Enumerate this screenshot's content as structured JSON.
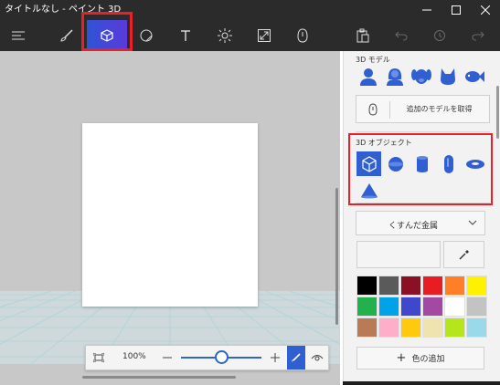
{
  "window": {
    "title": "タイトルなし - ペイント 3D",
    "controls": [
      "minimize-icon",
      "maximize-icon",
      "close-icon"
    ]
  },
  "toolbar": {
    "tools": [
      {
        "name": "menu",
        "icon": "hamburger-menu-icon"
      },
      {
        "name": "brushes",
        "icon": "brush-icon"
      },
      {
        "name": "3d-shapes",
        "icon": "3d-cube-icon",
        "active": true
      },
      {
        "name": "2d-shapes",
        "icon": "sticker-icon"
      },
      {
        "name": "text",
        "icon": "text-icon"
      },
      {
        "name": "effects",
        "icon": "sun-icon"
      },
      {
        "name": "canvas",
        "icon": "canvas-resize-icon"
      },
      {
        "name": "3d-library",
        "icon": "library-icon"
      },
      {
        "name": "paste",
        "icon": "paste-icon"
      },
      {
        "name": "undo",
        "icon": "undo-icon"
      },
      {
        "name": "history",
        "icon": "history-icon"
      },
      {
        "name": "redo",
        "icon": "redo-icon"
      }
    ],
    "accent": "#3b4fd8"
  },
  "zoom": {
    "percent": "100%",
    "level": 0.5,
    "icons": [
      "fit-screen-icon",
      "zoom-out-icon",
      "zoom-in-icon",
      "pen-icon",
      "view-icon"
    ]
  },
  "panel": {
    "models_title": "3D モデル",
    "models": [
      "man-icon",
      "woman-icon",
      "dog-icon",
      "cat-icon",
      "fish-icon"
    ],
    "get_more_label": "追加のモデルを取得",
    "objects_title": "3D オブジェクト",
    "objects": [
      "cube-icon",
      "sphere-icon",
      "cylinder-icon",
      "capsule-icon",
      "torus-icon",
      "cone-icon"
    ],
    "material": "くすんだ金属",
    "add_color_label": "色の追加",
    "palette": [
      "#000000",
      "#5a5a5a",
      "#8b1024",
      "#e81d23",
      "#ff7f27",
      "#fff200",
      "#22b14c",
      "#00a2e8",
      "#3f48cc",
      "#a349a4",
      "#ffffff",
      "#c3c3c3",
      "#b97a57",
      "#ffaec9",
      "#ffc90e",
      "#efe4b0",
      "#b5e61d",
      "#99d9ea"
    ]
  },
  "highlight_color": "#e8202a"
}
